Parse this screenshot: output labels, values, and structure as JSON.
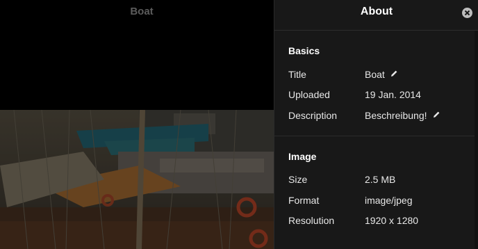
{
  "viewer": {
    "title": "Boat"
  },
  "panel": {
    "title": "About",
    "close_icon": "close-circle-icon",
    "sections": {
      "basics": {
        "heading": "Basics",
        "rows": {
          "title": {
            "label": "Title",
            "value": "Boat",
            "icon": "pencil-icon"
          },
          "uploaded": {
            "label": "Uploaded",
            "value": "19 Jan. 2014"
          },
          "description": {
            "label": "Description",
            "value": "Beschreibung!",
            "icon": "pencil-icon"
          }
        }
      },
      "image": {
        "heading": "Image",
        "rows": {
          "size": {
            "label": "Size",
            "value": "2.5 MB"
          },
          "format": {
            "label": "Format",
            "value": "image/jpeg"
          },
          "resolution": {
            "label": "Resolution",
            "value": "1920 x 1280"
          }
        }
      }
    }
  },
  "colors": {
    "panel_bg": "#181818",
    "viewer_bg": "#000000",
    "heading_text": "#ffffff"
  }
}
